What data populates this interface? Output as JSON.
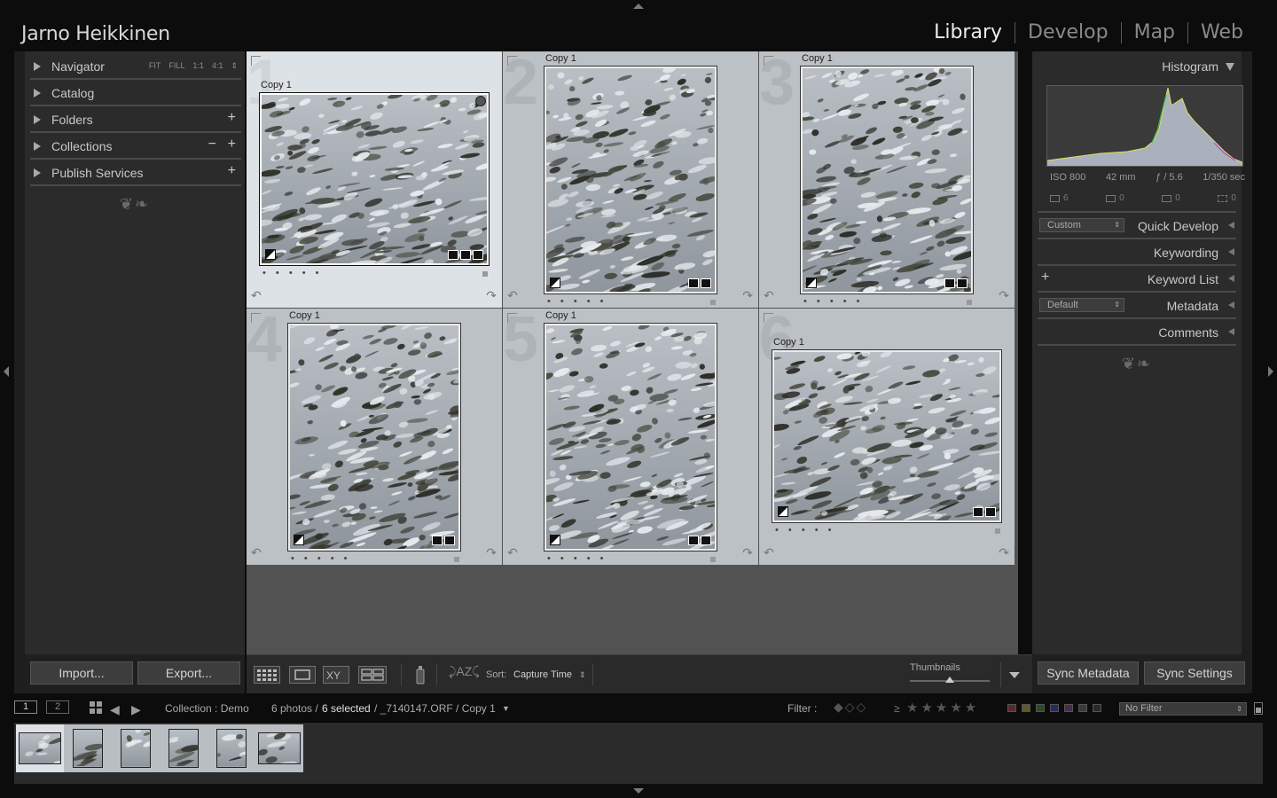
{
  "identity_plate": "Jarno Heikkinen",
  "modules": [
    {
      "label": "Library",
      "active": true
    },
    {
      "label": "Develop",
      "active": false
    },
    {
      "label": "Map",
      "active": false
    },
    {
      "label": "Web",
      "active": false
    }
  ],
  "left_panel": {
    "navigator": {
      "label": "Navigator",
      "options": [
        "FIT",
        "FILL",
        "1:1",
        "4:1"
      ]
    },
    "catalog": "Catalog",
    "folders": "Folders",
    "collections": "Collections",
    "publish_services": "Publish Services",
    "import_label": "Import...",
    "export_label": "Export..."
  },
  "right_panel": {
    "histogram": "Histogram",
    "exif": {
      "iso": "ISO 800",
      "focal": "42 mm",
      "aperture": "ƒ / 5.6",
      "shutter": "1/350 sec"
    },
    "counts": [
      "6",
      "0",
      "0",
      "0"
    ],
    "quick_develop": {
      "label": "Quick Develop",
      "preset": "Custom"
    },
    "keywording": "Keywording",
    "keyword_list": "Keyword List",
    "metadata": {
      "label": "Metadata",
      "preset": "Default"
    },
    "comments": "Comments",
    "sync_metadata_label": "Sync Metadata",
    "sync_settings_label": "Sync Settings"
  },
  "grid": {
    "cells": [
      {
        "index": "1",
        "copy": "Copy 1",
        "orientation": "landscape",
        "selected": true
      },
      {
        "index": "2",
        "copy": "Copy 1",
        "orientation": "portrait",
        "selected": false
      },
      {
        "index": "3",
        "copy": "Copy 1",
        "orientation": "portrait",
        "selected": false
      },
      {
        "index": "4",
        "copy": "Copy 1",
        "orientation": "portrait",
        "selected": false
      },
      {
        "index": "5",
        "copy": "Copy 1",
        "orientation": "portrait",
        "selected": false
      },
      {
        "index": "6",
        "copy": "Copy 1",
        "orientation": "landscape",
        "selected": false
      }
    ],
    "rating_dots": "• • • • •"
  },
  "toolbar": {
    "sort_label": "Sort:",
    "sort_value": "Capture Time",
    "thumbnails_label": "Thumbnails",
    "thumbnail_size": 0.5
  },
  "filmbar": {
    "page1": "1",
    "page2": "2",
    "collection": "Collection : Demo",
    "photo_count": "6 photos /",
    "selected_count": "6 selected",
    "file_info": "/ _7140147.ORF / Copy 1",
    "filter_label": "Filter :",
    "gte": "≥",
    "no_filter": "No Filter"
  },
  "colors": {
    "background": "#0c0c0c",
    "panel": "#2b2b2b",
    "cell": "#bcc1c6",
    "cell_selected": "#dde2e6",
    "histogram_fill": "#aab0bc"
  }
}
